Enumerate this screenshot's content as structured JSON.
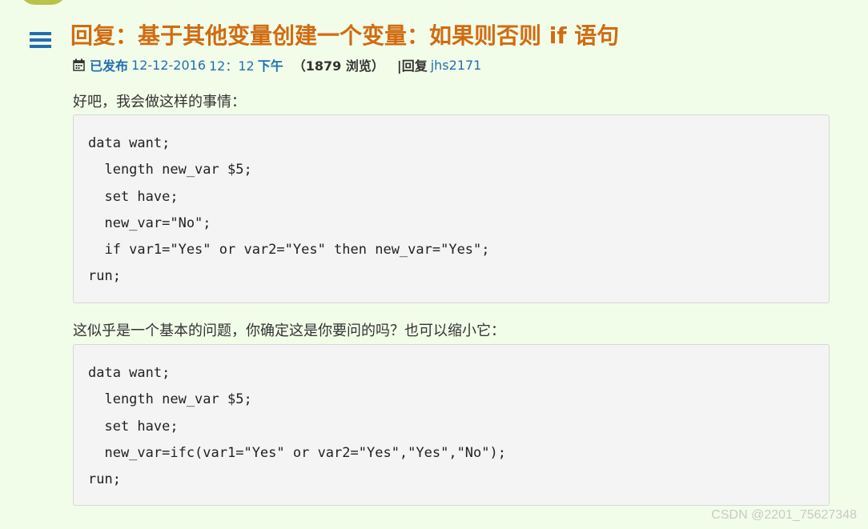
{
  "post": {
    "title": "回复：基于其他变量创建一个变量：如果则否则 if 语句",
    "meta": {
      "published_label": "已发布",
      "date": "12-12-2016",
      "time_prefix": "12：12",
      "time_suffix": "下午",
      "views": "（1879 浏览）",
      "reply_label": "|回复",
      "reply_user": "jhs2171"
    },
    "body": {
      "paragraph_1": "好吧，我会做这样的事情：",
      "code_block_1": [
        "data want;",
        "  length new_var $5;",
        "  set have;",
        "  new_var=\"No\";",
        "  if var1=\"Yes\" or var2=\"Yes\" then new_var=\"Yes\";",
        "run;"
      ],
      "paragraph_2": "这似乎是一个基本的问题，你确定这是你要问的吗？也可以缩小它：",
      "code_block_2": [
        "data want;",
        "  length new_var $5;",
        "  set have;",
        "  new_var=ifc(var1=\"Yes\" or var2=\"Yes\",\"Yes\",\"No\");",
        "run;"
      ]
    }
  },
  "watermark": "CSDN @2201_75627348",
  "icons": {
    "menu": "menu-icon",
    "calendar": "calendar-icon",
    "avatar": "avatar"
  },
  "colors": {
    "background": "#f2fde9",
    "title": "#d16b12",
    "accent": "#1f6fb2",
    "code_bg": "#f4f4f4"
  }
}
